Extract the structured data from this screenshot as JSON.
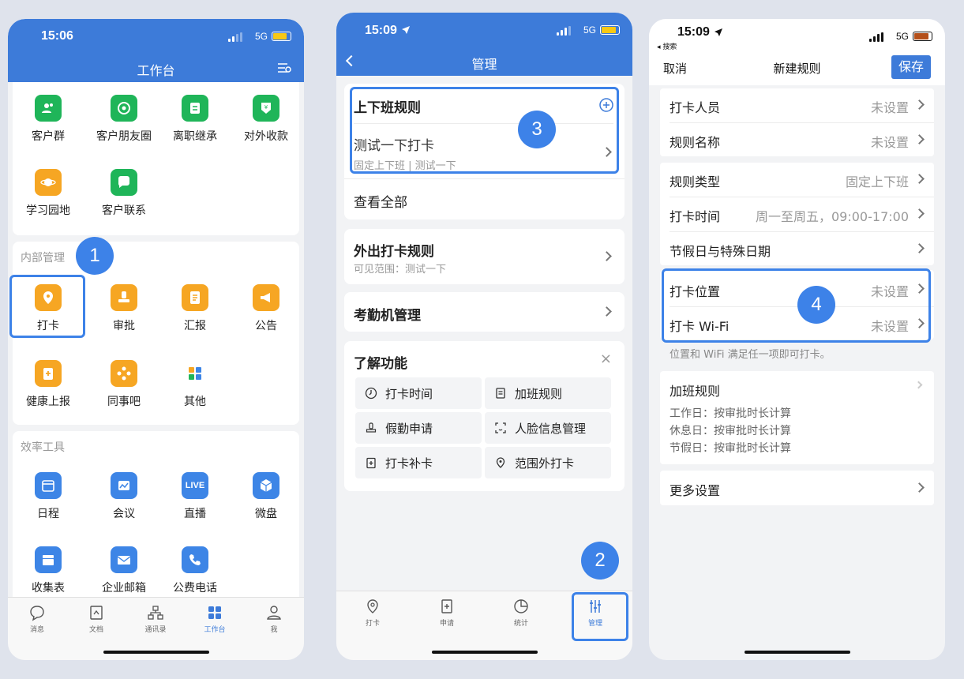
{
  "p1": {
    "time": "15:06",
    "net": "5G",
    "title": "工作台",
    "grid1": [
      "客户群",
      "客户朋友圈",
      "离职继承",
      "对外收款",
      "学习园地",
      "客户联系"
    ],
    "sec_internal": "内部管理",
    "grid2": [
      "打卡",
      "审批",
      "汇报",
      "公告",
      "健康上报",
      "同事吧",
      "其他"
    ],
    "sec_tools": "效率工具",
    "grid3": [
      "日程",
      "会议",
      "直播",
      "微盘",
      "收集表",
      "企业邮箱",
      "公费电话"
    ],
    "live_text": "LIVE",
    "tabs": [
      "消息",
      "文档",
      "通讯录",
      "工作台",
      "我"
    ],
    "badge": "1"
  },
  "p2": {
    "time": "15:09",
    "net": "5G",
    "title": "管理",
    "rule_header": "上下班规则",
    "rule_name": "测试一下打卡",
    "rule_sub": "固定上下班 | 测试一下",
    "view_all": "查看全部",
    "out_rule": "外出打卡规则",
    "out_sub": "可见范围：测试一下",
    "device": "考勤机管理",
    "learn": "了解功能",
    "close": "×",
    "features": [
      "打卡时间",
      "加班规则",
      "假勤申请",
      "人脸信息管理",
      "打卡补卡",
      "范围外打卡"
    ],
    "tabs": [
      "打卡",
      "申请",
      "统计",
      "管理"
    ],
    "badge3": "3",
    "badge2": "2"
  },
  "p3": {
    "time": "15:09",
    "net": "5G",
    "back": "◂ 搜索",
    "cancel": "取消",
    "title": "新建规则",
    "save": "保存",
    "rows1": [
      {
        "label": "打卡人员",
        "value": "未设置"
      },
      {
        "label": "规则名称",
        "value": "未设置"
      }
    ],
    "rows2": [
      {
        "label": "规则类型",
        "value": "固定上下班"
      },
      {
        "label": "打卡时间",
        "value": "周一至周五，09:00-17:00"
      },
      {
        "label": "节假日与特殊日期",
        "value": ""
      }
    ],
    "rows3": [
      {
        "label": "打卡位置",
        "value": "未设置"
      },
      {
        "label": "打卡 Wi-Fi",
        "value": "未设置"
      }
    ],
    "note": "位置和 WiFi 满足任一项即可打卡。",
    "ot_title": "加班规则",
    "ot_lines": [
      "工作日：按审批时长计算",
      "休息日：按审批时长计算",
      "节假日：按审批时长计算"
    ],
    "more": "更多设置",
    "badge4": "4"
  },
  "colors": {
    "brand": "#3d7bd9",
    "green": "#1fb559",
    "orange": "#f6a623",
    "badge": "#3d82e8"
  }
}
